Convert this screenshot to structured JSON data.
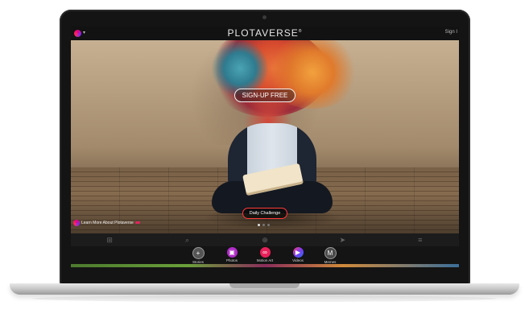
{
  "header": {
    "logo_text": "PLOTAVERSE",
    "logo_mark": "®",
    "signin_label": "Sign I",
    "menu_caret": "▾"
  },
  "hero": {
    "cta_label": "SIGN-UP FREE",
    "daily_challenge_label": "Daily Challenge",
    "learn_more_label": "Learn More About Plotaverse",
    "carousel": {
      "total": 3,
      "active": 1
    }
  },
  "nav": {
    "items": [
      {
        "name": "grid-icon",
        "glyph": "⊞"
      },
      {
        "name": "search-icon",
        "glyph": "⌕"
      },
      {
        "name": "add-icon",
        "glyph": "⊕"
      },
      {
        "name": "send-icon",
        "glyph": "➤"
      },
      {
        "name": "filter-icon",
        "glyph": "≡"
      }
    ]
  },
  "creators": {
    "items": [
      {
        "label": "Stories",
        "glyph": "+",
        "color": "#555555",
        "icon": "stories-add-icon"
      },
      {
        "label": "Photos",
        "glyph": "▣",
        "color": "#b02cc8",
        "icon": "photos-icon"
      },
      {
        "label": "Motion Art",
        "glyph": "∞",
        "color": "#e8205a",
        "icon": "motion-art-icon"
      },
      {
        "label": "Videos",
        "glyph": "▶",
        "color": "#2f6df0",
        "icon": "videos-play-icon"
      },
      {
        "label": "Memes",
        "glyph": "M",
        "color": "#4a4a4a",
        "icon": "memes-icon"
      }
    ]
  },
  "colors": {
    "accent_red": "#ff3b3b",
    "bar_dark": "#141414"
  }
}
